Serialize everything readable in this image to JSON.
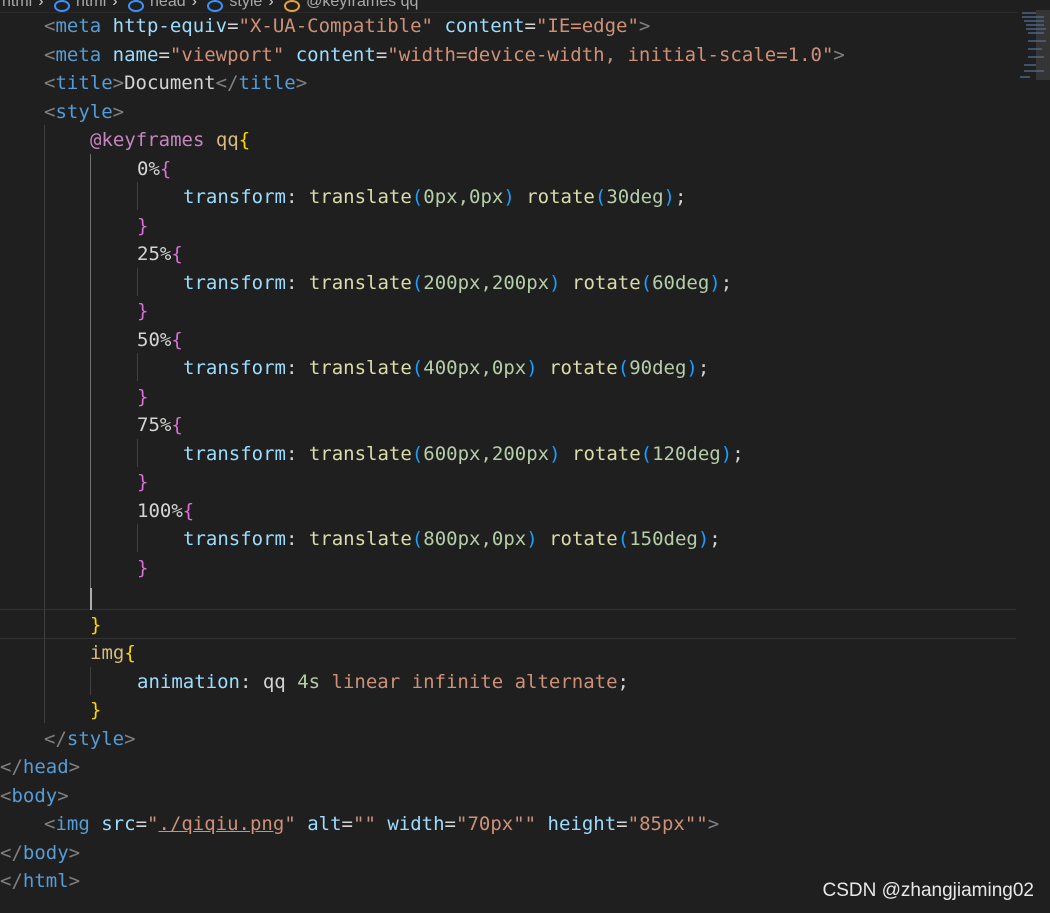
{
  "breadcrumb": {
    "items": [
      "html",
      "html",
      "head",
      "style",
      "@keyframes qq"
    ]
  },
  "code": {
    "l1": {
      "tag": "meta",
      "a1": "http-equiv",
      "v1": "\"X-UA-Compatible\"",
      "a2": "content",
      "v2": "\"IE=edge\""
    },
    "l2": {
      "tag": "meta",
      "a1": "name",
      "v1": "\"viewport\"",
      "a2": "content",
      "v2": "\"width=device-width, initial-scale=1.0\""
    },
    "l3": {
      "tag": "title",
      "text": "Document"
    },
    "l4": {
      "tag": "style"
    },
    "l5": {
      "at": "@keyframes",
      "name": "qq"
    },
    "k0": {
      "sel": "0%",
      "prop": "transform",
      "fn1": "translate",
      "args1": "0px,0px",
      "fn2": "rotate",
      "args2": "30deg"
    },
    "k25": {
      "sel": "25%",
      "prop": "transform",
      "fn1": "translate",
      "args1": "200px,200px",
      "fn2": "rotate",
      "args2": "60deg"
    },
    "k50": {
      "sel": "50%",
      "prop": "transform",
      "fn1": "translate",
      "args1": "400px,0px",
      "fn2": "rotate",
      "args2": "90deg"
    },
    "k75": {
      "sel": "75%",
      "prop": "transform",
      "fn1": "translate",
      "args1": "600px,200px",
      "fn2": "rotate",
      "args2": "120deg"
    },
    "k100": {
      "sel": "100%",
      "prop": "transform",
      "fn1": "translate",
      "args1": "800px,0px",
      "fn2": "rotate",
      "args2": "150deg"
    },
    "img_rule": {
      "sel": "img",
      "prop": "animation",
      "name": "qq",
      "dur": "4s",
      "timing": "linear",
      "iter": "infinite",
      "dir": "alternate"
    },
    "close_style": {
      "tag": "style"
    },
    "close_head": {
      "tag": "head"
    },
    "body_open": {
      "tag": "body"
    },
    "img_tag": {
      "tag": "img",
      "a1": "src",
      "v1": "./qiqiu.png",
      "a2": "alt",
      "v2": "\"\"",
      "a3": "width",
      "v3": "\"70px\"\"",
      "a4": "height",
      "v4": "\"85px\"\""
    },
    "close_body": {
      "tag": "body"
    },
    "close_html": {
      "tag": "html"
    }
  },
  "watermark": "CSDN @zhangjiaming02"
}
